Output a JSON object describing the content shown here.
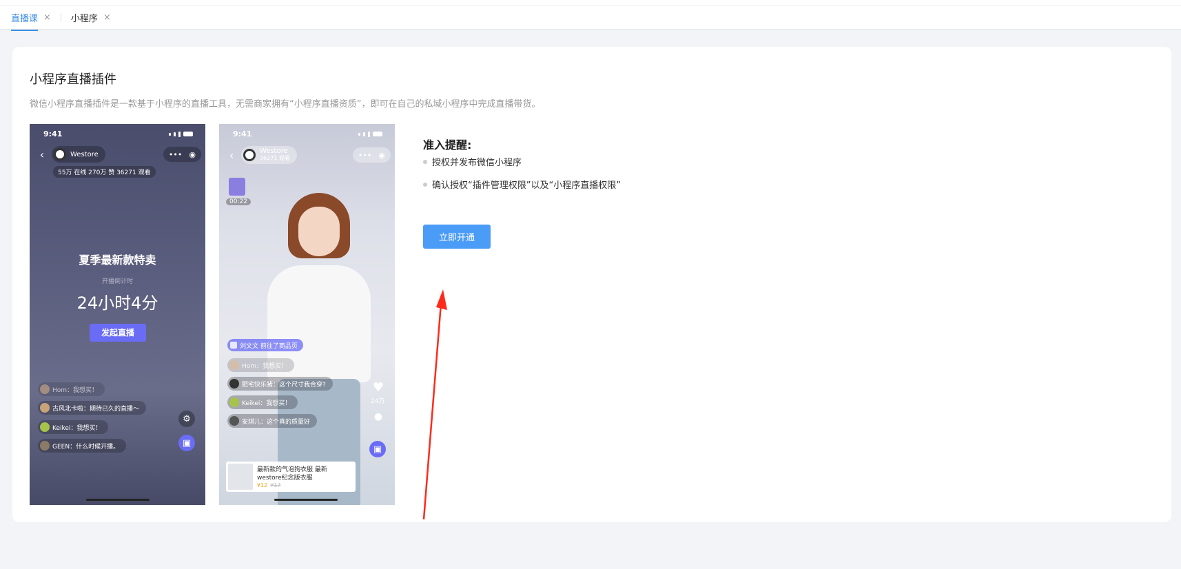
{
  "tabs": [
    {
      "label": "直播课",
      "active": true
    },
    {
      "label": "小程序",
      "active": false
    }
  ],
  "tab_close_glyph": "×",
  "card": {
    "title": "小程序直播插件",
    "description": "微信小程序直播插件是一款基于小程序的直播工具，无需商家拥有“小程序直播资质”，即可在自己的私域小程序中完成直播带货。"
  },
  "phone1": {
    "time": "9:41",
    "store": "Westore",
    "stats": "55万 在线  270万 赞  36271 观看",
    "headline": "夏季最新款特卖",
    "countdown_label": "开播倒计时",
    "countdown": "24小时4分",
    "start_button": "发起直播",
    "comments": [
      "Hom：我想买！",
      "古风北卡啦：期待已久的直播～",
      "Keikei：我想买！",
      "GEEN：什么时候开播。"
    ]
  },
  "phone2": {
    "time": "9:41",
    "store": "Westore",
    "viewers": "36271 观看",
    "gift_timer": "00:22",
    "notice": "刘文文 前往了商品页",
    "likes": "24万",
    "comments": [
      "Hom：我想买！",
      "肥宅快乐猪：这个尺寸我合穿?",
      "Keikei：我想买！",
      "安琪儿：这个真的质量好"
    ],
    "product": {
      "name_line1": "最新款的气泡狗衣服 最新",
      "name_line2": "westore纪念版衣服",
      "price": "¥12",
      "old_price": "¥17"
    }
  },
  "requirements": {
    "title": "准入提醒:",
    "items": [
      "授权并发布微信小程序",
      "确认授权“插件管理权限”以及“小程序直播权限”"
    ],
    "button": "立即开通"
  },
  "colors": {
    "accent": "#3a8ee6",
    "button": "#4a9cf7",
    "annotation_arrow": "#ff2a1a"
  }
}
